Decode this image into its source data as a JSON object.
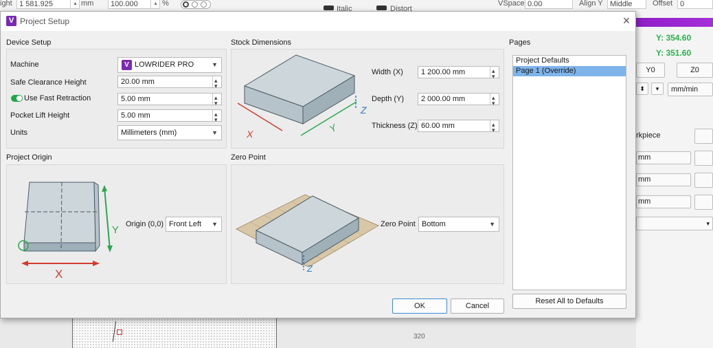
{
  "background": {
    "toolbar": {
      "height_label": "ight",
      "height_value": "1 581.925",
      "unit": "mm",
      "scale_value": "100.000",
      "percent": "%",
      "italic_label": "Italic",
      "distort_label": "Distort",
      "vspace_label": "VSpace",
      "vspace_value": "0.00",
      "align_y_label": "Align Y",
      "align_y_value": "Middle",
      "offset_label": "Offset",
      "offset_value": "0"
    },
    "right_panel": {
      "coord_y1": "Y: 354.60",
      "coord_y2": "Y: 351.60",
      "y0_label": "Y0",
      "z0_label": "Z0",
      "speed_unit": "mm/min",
      "workpiece_label": "rkpiece",
      "field1": "mm",
      "field2": "mm",
      "field3": "mm"
    },
    "ruler_value": "320"
  },
  "dialog": {
    "title": "Project Setup",
    "device_setup": {
      "title": "Device Setup",
      "machine_label": "Machine",
      "machine_value": "LOWRIDER PRO",
      "clearance_label": "Safe Clearance Height",
      "clearance_value": "20.00 mm",
      "fast_retraction_label": "Use Fast Retraction",
      "fast_retraction_value": "5.00 mm",
      "pocket_lift_label": "Pocket Lift Height",
      "pocket_lift_value": "5.00 mm",
      "units_label": "Units",
      "units_value": "Millimeters (mm)"
    },
    "stock": {
      "title": "Stock Dimensions",
      "width_label": "Width (X)",
      "width_value": "1 200.00 mm",
      "depth_label": "Depth (Y)",
      "depth_value": "2 000.00 mm",
      "thickness_label": "Thickness (Z)",
      "thickness_value": "60.00 mm"
    },
    "origin": {
      "title": "Project Origin",
      "origin_label": "Origin (0,0)",
      "origin_value": "Front Left"
    },
    "zero_point": {
      "title": "Zero Point",
      "label": "Zero Point",
      "value": "Bottom"
    },
    "pages": {
      "title": "Pages",
      "items": [
        {
          "label": "Project Defaults",
          "selected": false
        },
        {
          "label": "Page 1  (Override)",
          "selected": true
        }
      ],
      "reset_label": "Reset All to Defaults"
    },
    "ok_label": "OK",
    "cancel_label": "Cancel"
  },
  "colors": {
    "accent_purple": "#8e1fc7",
    "coord_green": "#27b24a",
    "selection_blue": "#7eb4ea",
    "axis_red": "#d23b30",
    "axis_green": "#2aa84f",
    "axis_blue": "#2a7fc1"
  }
}
